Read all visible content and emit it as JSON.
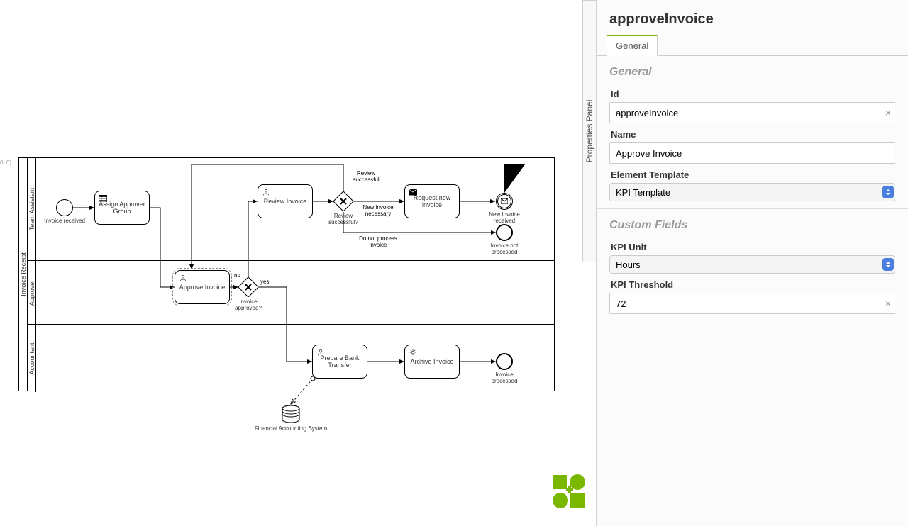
{
  "coords": "0, 0)",
  "props_panel": {
    "toggle_label": "Properties Panel",
    "title": "approveInvoice",
    "tab_general": "General",
    "general": {
      "heading": "General",
      "id_label": "Id",
      "id_value": "approveInvoice",
      "name_label": "Name",
      "name_value": "Approve Invoice",
      "template_label": "Element Template",
      "template_value": "KPI Template"
    },
    "custom": {
      "heading": "Custom Fields",
      "kpi_unit_label": "KPI Unit",
      "kpi_unit_value": "Hours",
      "kpi_threshold_label": "KPI Threshold",
      "kpi_threshold_value": "72"
    }
  },
  "pool": {
    "name": "Invoice Receipt",
    "lanes": [
      {
        "name": "Team Assistant"
      },
      {
        "name": "Approver"
      },
      {
        "name": "Accountant"
      }
    ]
  },
  "nodes": {
    "start": {
      "label": "Invoice received"
    },
    "assign": {
      "label": "Assign Approver Group"
    },
    "approve": {
      "label": "Approve Invoice"
    },
    "gw_approved": {
      "label": "Invoice approved?"
    },
    "review": {
      "label": "Review Invoice"
    },
    "gw_review": {
      "label": "Review successful?"
    },
    "request": {
      "label": "Request new invoice"
    },
    "msg": {
      "label": "New Invoice received"
    },
    "end_notproc": {
      "label": "Invoice not processed"
    },
    "prepare": {
      "label": "Prepare Bank Transfer"
    },
    "archive": {
      "label": "Archive Invoice"
    },
    "end_proc": {
      "label": "Invoice processed"
    },
    "data_store": {
      "label": "Financial Accounting System"
    }
  },
  "flow_labels": {
    "review_successful": "Review successful",
    "new_invoice_necessary": "New invoice necessary",
    "do_not_process": "Do not process invoice",
    "no": "no",
    "yes": "yes"
  }
}
